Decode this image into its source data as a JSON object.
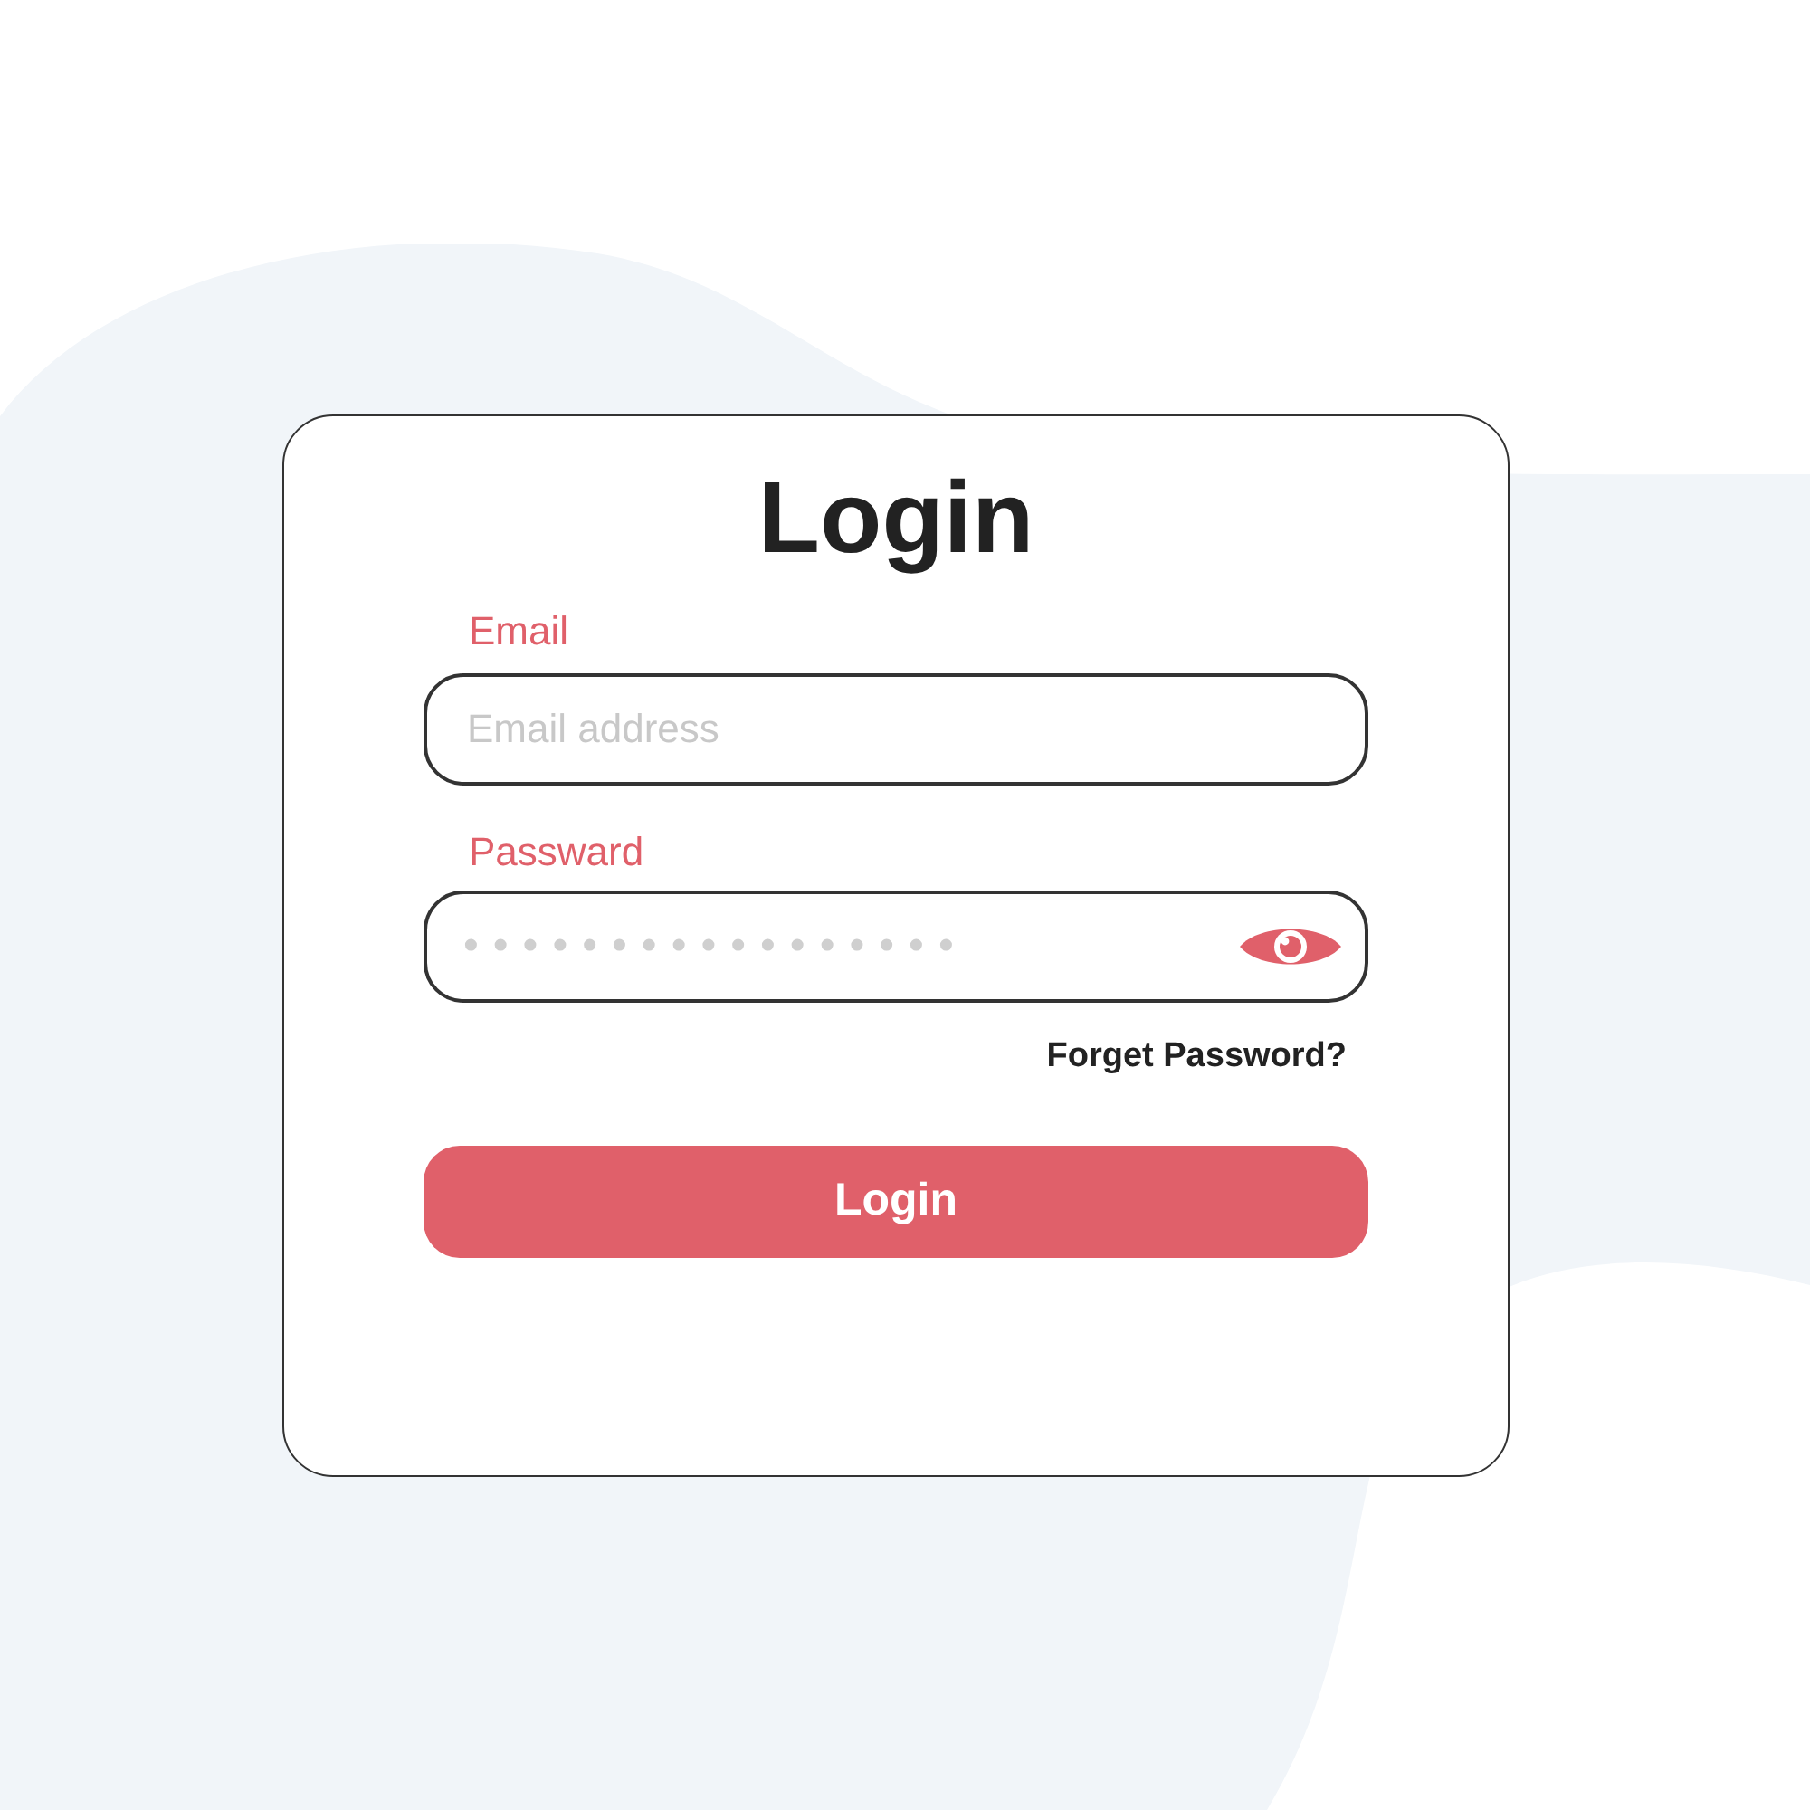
{
  "title": "Login",
  "email": {
    "label": "Email",
    "placeholder": "Email address"
  },
  "password": {
    "label": "Passward",
    "masked_value": "•••••••••••••••••"
  },
  "forgot_link": "Forget Password?",
  "login_button": "Login"
}
